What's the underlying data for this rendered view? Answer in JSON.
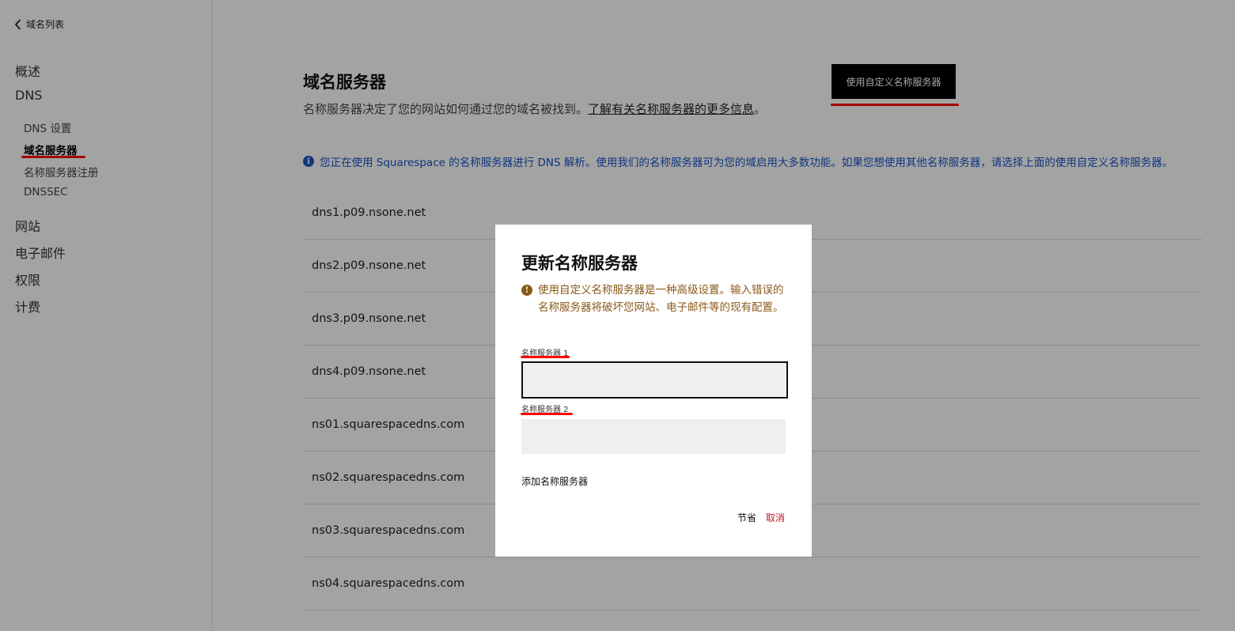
{
  "sidebar": {
    "back_label": "域名列表",
    "nav": {
      "overview": "概述",
      "dns": "DNS",
      "dns_settings": "DNS 设置",
      "nameservers": "域名服务器",
      "nameserver_registration": "名称服务器注册",
      "dnssec": "DNSSEC",
      "website": "网站",
      "email": "电子邮件",
      "permissions": "权限",
      "billing": "计费"
    }
  },
  "main": {
    "title": "域名服务器",
    "description": "名称服务器决定了您的网站如何通过您的域名被找到。",
    "learn_more_link": "了解有关名称服务器的更多信息",
    "description_end": "。",
    "custom_button": "使用自定义名称服务器",
    "info_banner": "您正在使用 Squarespace 的名称服务器进行 DNS 解析。使用我们的名称服务器可为您的域启用大多数功能。如果您想使用其他名称服务器，请选择上面的使用自定义名称服务器。",
    "nameservers": [
      "dns1.p09.nsone.net",
      "dns2.p09.nsone.net",
      "dns3.p09.nsone.net",
      "dns4.p09.nsone.net",
      "ns01.squarespacedns.com",
      "ns02.squarespacedns.com",
      "ns03.squarespacedns.com",
      "ns04.squarespacedns.com"
    ]
  },
  "modal": {
    "title": "更新名称服务器",
    "warning": "使用自定义名称服务器是一种高级设置。输入错误的名称服务器将破坏您网站、电子邮件等的现有配置。",
    "field1_label": "名称服务器 1",
    "field1_value": "",
    "field2_label": "名称服务器 2",
    "field2_value": "",
    "add_label": "添加名称服务器",
    "save_label": "节省",
    "cancel_label": "取消"
  },
  "icons": {
    "back": "chevron-left-icon",
    "info": "info-icon",
    "warning": "warning-icon"
  },
  "colors": {
    "info_blue": "#1a55c7",
    "warning_brown": "#8a5a1a",
    "cancel_red": "#c0141d",
    "annotation_red": "#ff0000",
    "button_black": "#000000"
  }
}
